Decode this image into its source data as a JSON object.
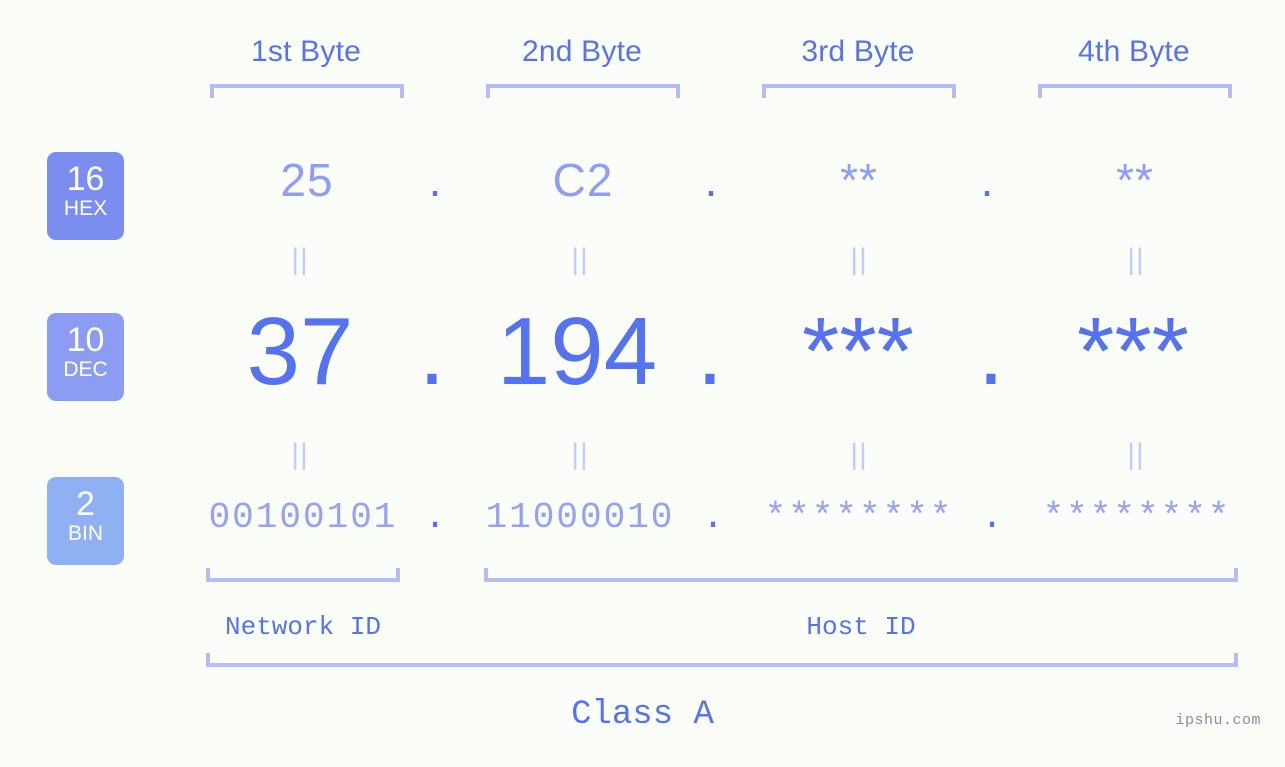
{
  "meta": {
    "background_color": "#fbfdf8",
    "accent_color": "#5573f0",
    "muted_accent_color": "#8f9ef5",
    "bracket_color": "#b3bdfa",
    "connector_color": "#c3ccfb",
    "watermark_color": "#8a8f96"
  },
  "watermark": "ipshu.com",
  "byte_headers": [
    {
      "label": "1st Byte"
    },
    {
      "label": "2nd Byte"
    },
    {
      "label": "3rd Byte"
    },
    {
      "label": "4th Byte"
    }
  ],
  "bases": [
    {
      "number": "16",
      "abbr": "HEX",
      "color": "#7b8ef0"
    },
    {
      "number": "10",
      "abbr": "DEC",
      "color": "#8c9cf2"
    },
    {
      "number": "2",
      "abbr": "BIN",
      "color": "#8fb0f3"
    }
  ],
  "rows": {
    "hex": {
      "values": [
        "25",
        "C2",
        "**",
        "**"
      ],
      "separators": [
        ".",
        ".",
        "."
      ]
    },
    "dec": {
      "values": [
        "37",
        "194",
        "***",
        "***"
      ],
      "separators": [
        ".",
        ".",
        "."
      ]
    },
    "bin": {
      "values": [
        "00100101",
        "11000010",
        "********",
        "********"
      ],
      "separators": [
        ".",
        ".",
        "."
      ]
    }
  },
  "connectors": {
    "symbol": "||",
    "count_per_row": 4
  },
  "sections": [
    {
      "label": "Network ID"
    },
    {
      "label": "Host ID"
    }
  ],
  "class_label": "Class A"
}
